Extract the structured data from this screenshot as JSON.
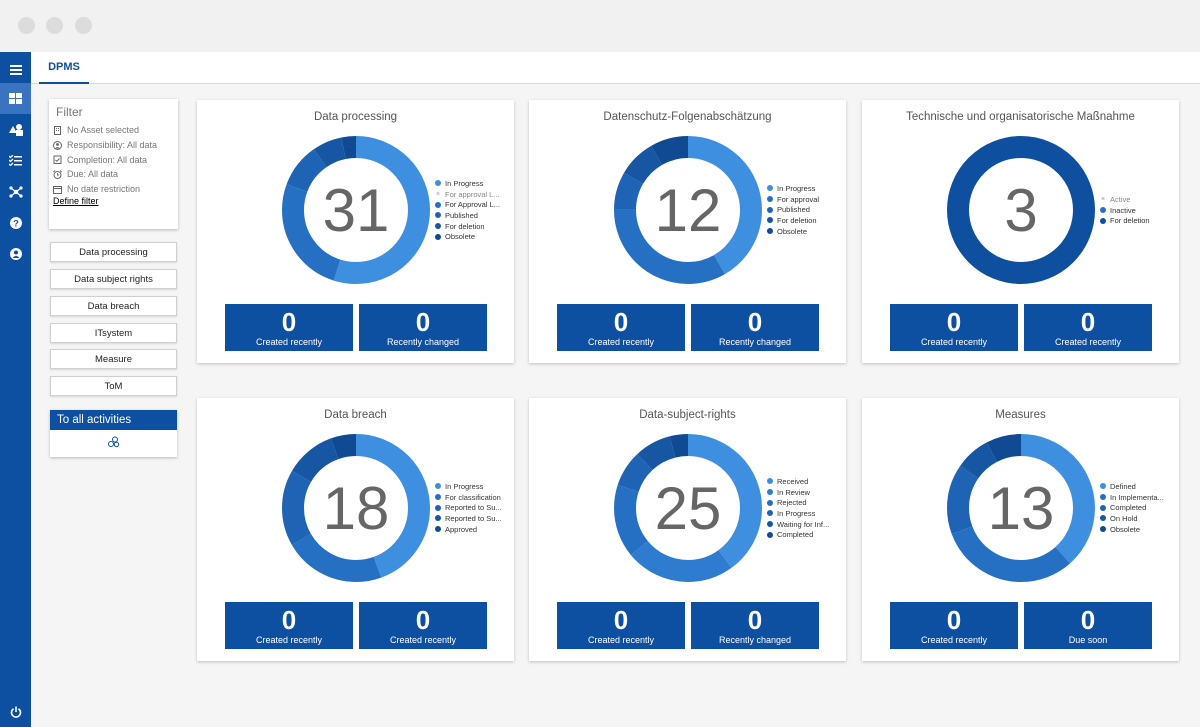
{
  "nav": {
    "tab": "DPMS"
  },
  "filter": {
    "title": "Filter",
    "rows": [
      {
        "icon": "building-icon",
        "text": "No Asset selected"
      },
      {
        "icon": "user-circle-icon",
        "text": "Responsibility: All data"
      },
      {
        "icon": "clipboard-check-icon",
        "text": "Completion: All data"
      },
      {
        "icon": "alarm-clock-icon",
        "text": "Due: All data"
      },
      {
        "icon": "calendar-icon",
        "text": "No date restriction"
      }
    ],
    "define": "Define filter"
  },
  "side_buttons": [
    "Data processing",
    "Data subject rights",
    "Data breach",
    "ITsystem",
    "Measure",
    "ToM"
  ],
  "all_activities": {
    "label": "To all activities",
    "icon": "activities-icon"
  },
  "cards": [
    {
      "title": "Data processing",
      "total": "31",
      "segments": [
        {
          "label": "In Progress",
          "value": 17,
          "color": "#3f8fe0"
        },
        {
          "label": "For approval L...",
          "value": 0,
          "color": "#999999",
          "inactive": true
        },
        {
          "label": "For Approval L...",
          "value": 8,
          "color": "#2670c4"
        },
        {
          "label": "Published",
          "value": 3,
          "color": "#1f63b4"
        },
        {
          "label": "For deletion",
          "value": 2,
          "color": "#1656a3"
        },
        {
          "label": "Obsolete",
          "value": 1,
          "color": "#0f4a93"
        }
      ],
      "stats": [
        {
          "value": "0",
          "label": "Created recently"
        },
        {
          "value": "0",
          "label": "Recently changed"
        }
      ]
    },
    {
      "title": "Datenschutz-Folgenabschätzung",
      "total": "12",
      "segments": [
        {
          "label": "In Progress",
          "value": 5,
          "color": "#3f8fe0"
        },
        {
          "label": "For approval",
          "value": 4,
          "color": "#2670c4"
        },
        {
          "label": "Published",
          "value": 1,
          "color": "#1f63b4"
        },
        {
          "label": "For deletion",
          "value": 1,
          "color": "#1656a3"
        },
        {
          "label": "Obsolete",
          "value": 1,
          "color": "#0f4a93"
        }
      ],
      "stats": [
        {
          "value": "0",
          "label": "Created recently"
        },
        {
          "value": "0",
          "label": "Recently changed"
        }
      ]
    },
    {
      "title": "Technische und organisatorische Maßnahme",
      "total": "3",
      "segments": [
        {
          "label": "Active",
          "value": 0,
          "color": "#999999",
          "inactive": true
        },
        {
          "label": "Inactive",
          "value": 0,
          "color": "#2670c4"
        },
        {
          "label": "For deletion",
          "value": 3,
          "color": "#0f4fa0"
        }
      ],
      "stats": [
        {
          "value": "0",
          "label": "Created recently"
        },
        {
          "value": "0",
          "label": "Created recently"
        }
      ]
    },
    {
      "title": "Data breach",
      "total": "18",
      "segments": [
        {
          "label": "In Progress",
          "value": 8,
          "color": "#3f8fe0"
        },
        {
          "label": "For classification",
          "value": 4,
          "color": "#2670c4"
        },
        {
          "label": "Reported to Su...",
          "value": 3,
          "color": "#1f63b4"
        },
        {
          "label": "Reported to Su...",
          "value": 2,
          "color": "#1656a3"
        },
        {
          "label": "Approved",
          "value": 1,
          "color": "#0f4a93"
        }
      ],
      "stats": [
        {
          "value": "0",
          "label": "Created recently"
        },
        {
          "value": "0",
          "label": "Created recently"
        }
      ]
    },
    {
      "title": "Data-subject-rights",
      "total": "25",
      "segments": [
        {
          "label": "Received",
          "value": 10,
          "color": "#3f8fe0"
        },
        {
          "label": "In Review",
          "value": 6,
          "color": "#2f7bd0"
        },
        {
          "label": "Rejected",
          "value": 4,
          "color": "#2670c4"
        },
        {
          "label": "In Progress",
          "value": 2,
          "color": "#1f63b4"
        },
        {
          "label": "Waiting for Inf...",
          "value": 2,
          "color": "#1656a3"
        },
        {
          "label": "Completed",
          "value": 1,
          "color": "#0f4a93"
        }
      ],
      "stats": [
        {
          "value": "0",
          "label": "Created recently"
        },
        {
          "value": "0",
          "label": "Recently changed"
        }
      ]
    },
    {
      "title": "Measures",
      "total": "13",
      "segments": [
        {
          "label": "Defined",
          "value": 5,
          "color": "#3f8fe0"
        },
        {
          "label": "In Implementa...",
          "value": 4,
          "color": "#2670c4"
        },
        {
          "label": "Completed",
          "value": 2,
          "color": "#1f63b4"
        },
        {
          "label": "On Hold",
          "value": 1,
          "color": "#1656a3"
        },
        {
          "label": "Obsolete",
          "value": 1,
          "color": "#0f4a93"
        }
      ],
      "stats": [
        {
          "value": "0",
          "label": "Created recently"
        },
        {
          "value": "0",
          "label": "Due soon"
        }
      ]
    }
  ]
}
